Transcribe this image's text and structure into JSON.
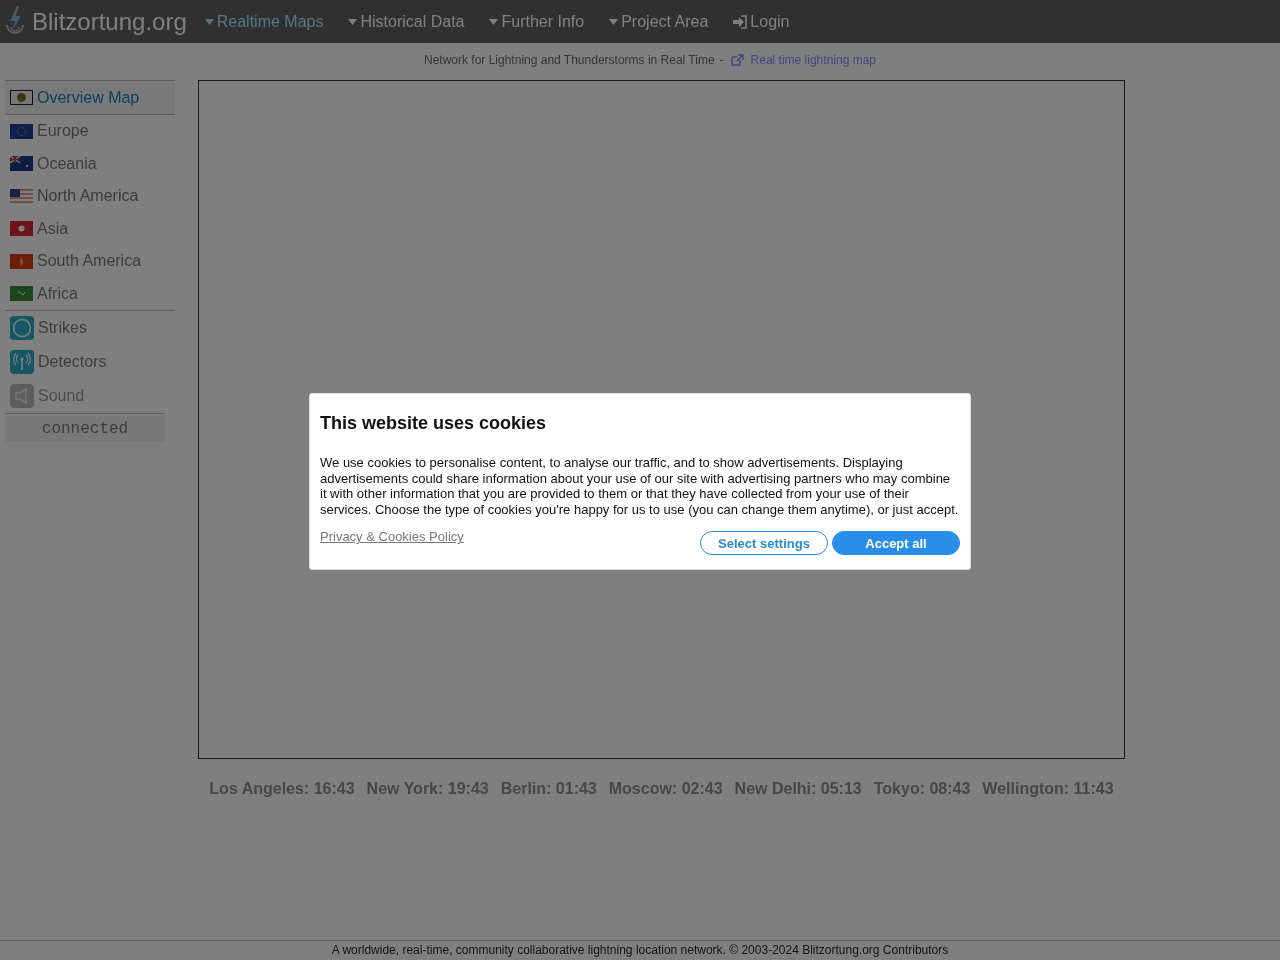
{
  "header": {
    "logo": "Blitzortung.org",
    "nav": [
      {
        "label": "Realtime Maps",
        "selected": true,
        "kind": "menu"
      },
      {
        "label": "Historical Data",
        "selected": false,
        "kind": "menu"
      },
      {
        "label": "Further Info",
        "selected": false,
        "kind": "menu"
      },
      {
        "label": "Project Area",
        "selected": false,
        "kind": "menu"
      },
      {
        "label": "Login",
        "selected": false,
        "kind": "login"
      }
    ]
  },
  "subheader": {
    "text": "Network for Lightning and Thunderstorms in Real Time",
    "separator": "-",
    "link": "Real time lightning map"
  },
  "sidebar": {
    "regions": [
      {
        "label": "Overview Map",
        "selected": true
      },
      {
        "label": "Europe",
        "selected": false
      },
      {
        "label": "Oceania",
        "selected": false
      },
      {
        "label": "North America",
        "selected": false
      },
      {
        "label": "Asia",
        "selected": false
      },
      {
        "label": "South America",
        "selected": false
      },
      {
        "label": "Africa",
        "selected": false
      }
    ],
    "layers": [
      {
        "label": "Strikes",
        "kind": "strikes",
        "on": true
      },
      {
        "label": "Detectors",
        "kind": "detectors",
        "on": true
      },
      {
        "label": "Sound",
        "kind": "sound",
        "on": false
      }
    ],
    "status": "connected"
  },
  "clocks": [
    "Los Angeles: 16:43",
    "New York: 19:43",
    "Berlin: 01:43",
    "Moscow: 02:43",
    "New Delhi: 05:13",
    "Tokyo: 08:43",
    "Wellington: 11:43"
  ],
  "footer": "A worldwide, real-time, community collaborative lightning location network. © 2003-2024 Blitzortung.org Contributors",
  "cookie_dialog": {
    "title": "This website uses cookies",
    "text": "We use cookies to personalise content, to analyse our traffic, and to show advertisements. Displaying advertisements could share information about your use of our site with advertising partners who may combine it with other information that you are provided to them or that they have collected from your use of their services. Choose the type of cookies you're happy for us to use (you can change them anytime), or just accept.",
    "policy_link": "Privacy & Cookies Policy",
    "buttons": [
      {
        "label": "Select settings",
        "kind": "secondary"
      },
      {
        "label": "Accept all",
        "kind": "primary"
      }
    ]
  }
}
